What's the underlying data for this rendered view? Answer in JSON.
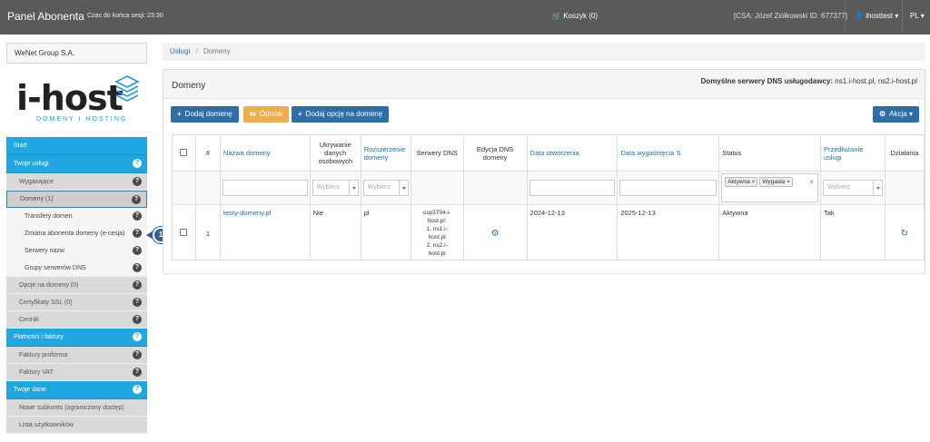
{
  "topbar": {
    "brand": "Panel Abonenta",
    "session": "Czas do końca sesji: 23:30",
    "cart": "Koszyk (0)",
    "csa": "[CSA: Józef Ziółkowski ID: 677377]",
    "user": "ihosttest",
    "lang": "PL"
  },
  "sidebar": {
    "company": "WeNet Group S.A.",
    "logo_word": "i-host",
    "logo_sub": "DOMENY I HOSTING",
    "items": [
      {
        "label": "Start",
        "kind": "section",
        "help": false
      },
      {
        "label": "Twoje usługi",
        "kind": "section",
        "help": true
      },
      {
        "label": "Wygasające",
        "kind": "sub",
        "help": true
      },
      {
        "label": "Domeny (1)",
        "kind": "sub-active",
        "help": true
      },
      {
        "label": "Transfery domen",
        "kind": "subsub",
        "help": true
      },
      {
        "label": "Zmiana abonenta domeny (e-cesja)",
        "kind": "subsub",
        "help": true
      },
      {
        "label": "Serwery nazw",
        "kind": "subsub",
        "help": true
      },
      {
        "label": "Grupy serwerów DNS",
        "kind": "subsub",
        "help": true
      },
      {
        "label": "Opcje na domeny (0)",
        "kind": "sub",
        "help": true
      },
      {
        "label": "Certyfikaty SSL (0)",
        "kind": "sub",
        "help": true
      },
      {
        "label": "Cennik",
        "kind": "sub",
        "help": true
      },
      {
        "label": "Płatności i faktury",
        "kind": "section",
        "help": true
      },
      {
        "label": "Faktury proforma",
        "kind": "sub",
        "help": true
      },
      {
        "label": "Faktury VAT",
        "kind": "sub",
        "help": true
      },
      {
        "label": "Twoje dane",
        "kind": "section",
        "help": true
      },
      {
        "label": "Nowe subkonto (ograniczony dostęp)",
        "kind": "sub",
        "help": false
      },
      {
        "label": "Lista użytkowników",
        "kind": "sub",
        "help": false
      }
    ],
    "callout_number": "1"
  },
  "breadcrumb": {
    "link": "Usługi",
    "divider": "/",
    "current": "Domeny"
  },
  "panel": {
    "title": "Domeny",
    "dns_label": "Domyślne serwery DNS usługodawcy:",
    "dns_value": "ns1.i-host.pl, ns2.i-host.pl",
    "buttons": {
      "add_domain": "Dodaj domenę",
      "renew": "Odnów",
      "add_option": "Dodaj opcję na domenę",
      "action": "Akcja"
    }
  },
  "table": {
    "headers": {
      "hash": "#",
      "domain": "Nazwa domeny",
      "privacy": "Ukrywanie danych osobowych",
      "extension": "Rozszerzenie domeny",
      "dns": "Serwery DNS",
      "dns_edit": "Edycja DNS domeny",
      "created": "Data utworzenia",
      "expires": "Data wygaśnięcia",
      "status": "Status",
      "extend": "Przedłużanie usługi",
      "actions": "Działania"
    },
    "filters": {
      "select_placeholder": "Wybierz",
      "status_tags": [
        "Aktywna",
        "Wygasła"
      ]
    },
    "rows": [
      {
        "num": "1",
        "domain": "testy-domeny.pl",
        "privacy": "Nie",
        "extension": "pl",
        "dns_group": "csp3794-i-host.pl:",
        "dns_1": "1. ns1.i-",
        "dns_1b": "host.pl",
        "dns_2": "2. ns2.i-",
        "dns_2b": "host.pl",
        "created": "2024-12-13",
        "expires": "2025-12-13",
        "status": "Aktywna",
        "extend": "Tak"
      }
    ]
  }
}
